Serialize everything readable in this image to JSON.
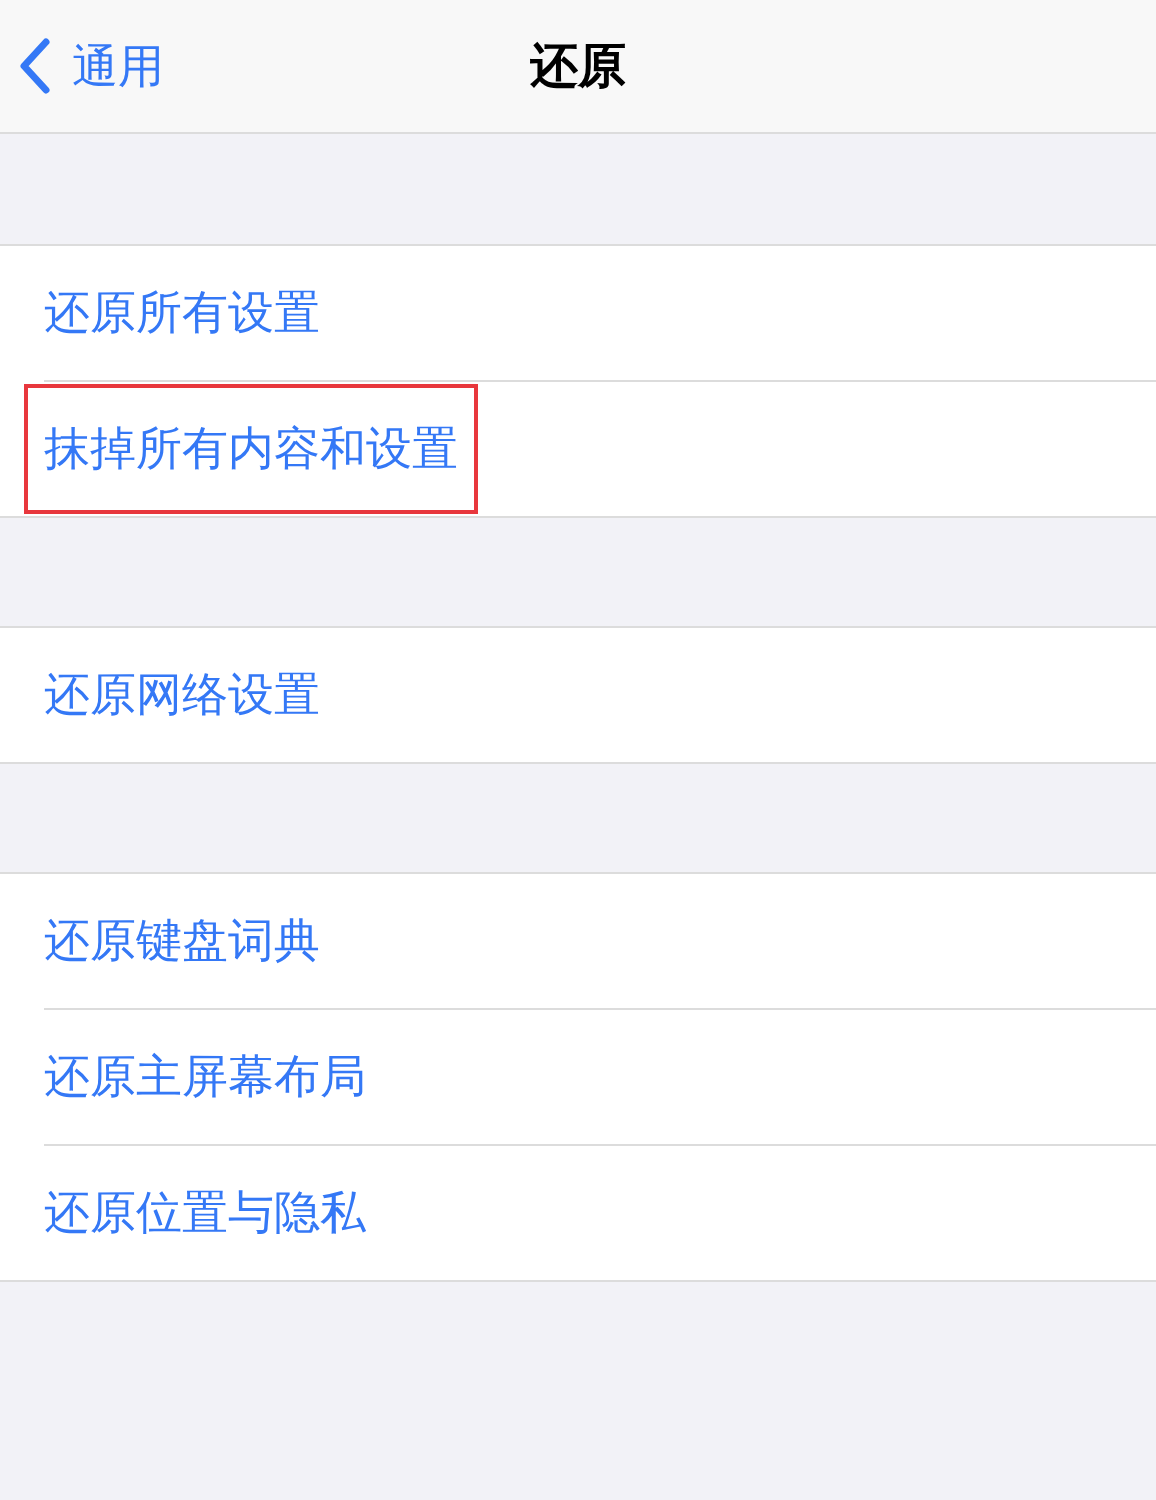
{
  "nav": {
    "back": "通用",
    "title": "还原"
  },
  "groups": [
    {
      "items": [
        {
          "label": "还原所有设置",
          "highlighted": false
        },
        {
          "label": "抹掉所有内容和设置",
          "highlighted": true
        }
      ]
    },
    {
      "items": [
        {
          "label": "还原网络设置",
          "highlighted": false
        }
      ]
    },
    {
      "items": [
        {
          "label": "还原键盘词典",
          "highlighted": false
        },
        {
          "label": "还原主屏幕布局",
          "highlighted": false
        },
        {
          "label": "还原位置与隐私",
          "highlighted": false
        }
      ]
    }
  ]
}
